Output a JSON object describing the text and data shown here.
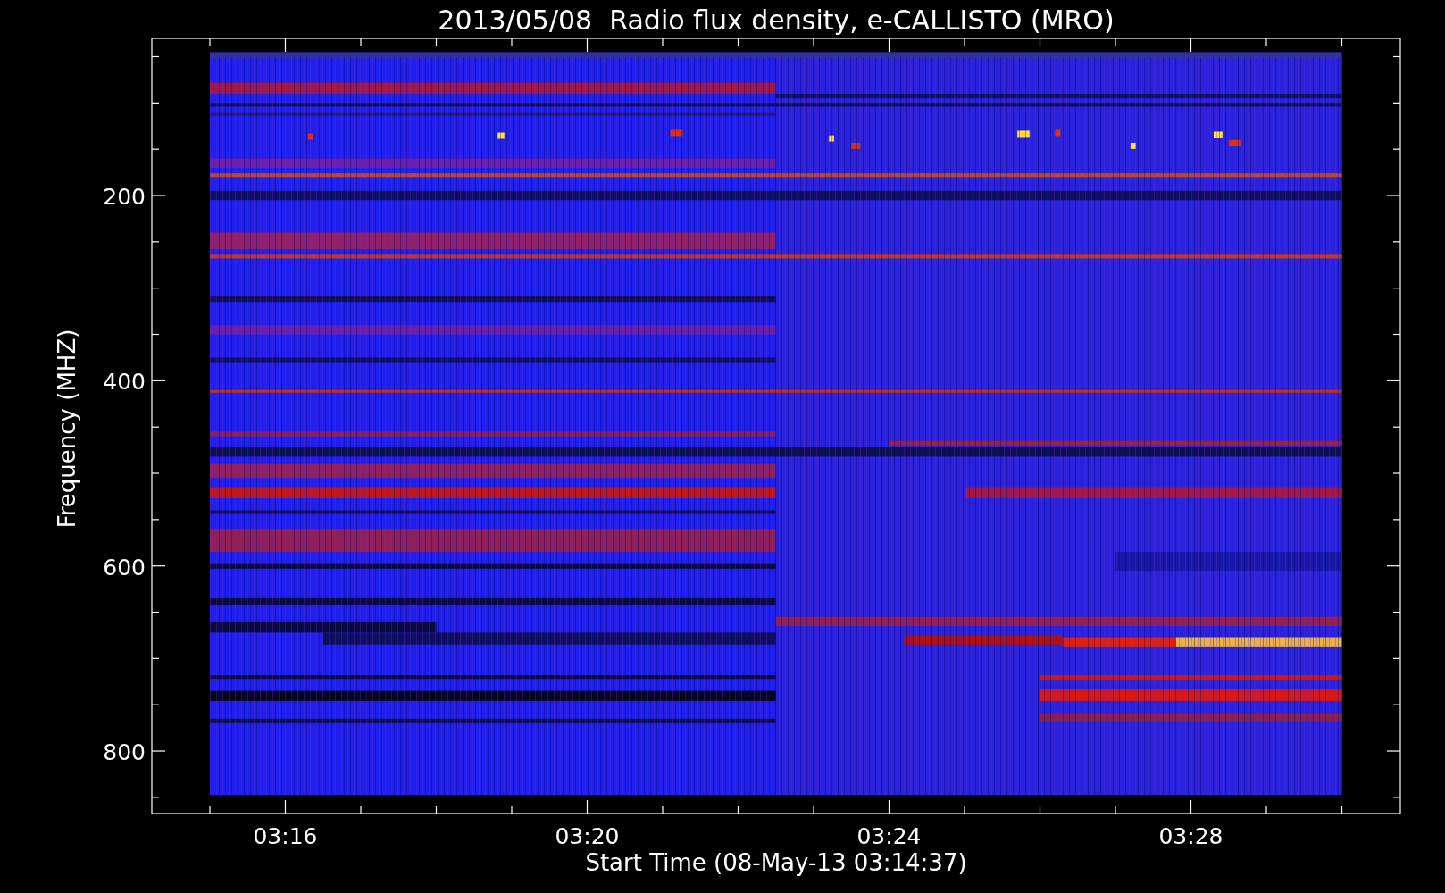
{
  "title": "2013/05/08  Radio flux density, e-CALLISTO (MRO)",
  "y_axis": {
    "label": "Frequency (MHZ)",
    "ticks": [
      "200",
      "400",
      "600",
      "800"
    ]
  },
  "x_axis": {
    "label": "Start Time (08-May-13 03:14:37)",
    "ticks": [
      "03:16",
      "03:20",
      "03:24",
      "03:28"
    ]
  }
}
